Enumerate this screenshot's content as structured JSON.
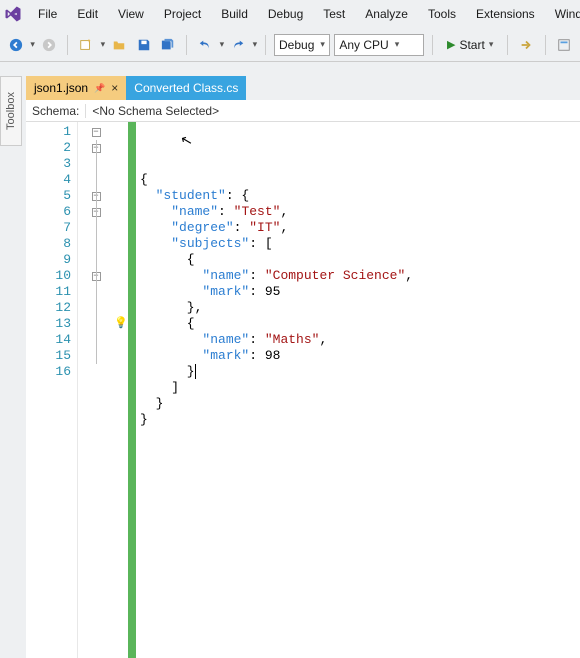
{
  "menu": {
    "items": [
      "File",
      "Edit",
      "View",
      "Project",
      "Build",
      "Debug",
      "Test",
      "Analyze",
      "Tools",
      "Extensions",
      "Wind"
    ]
  },
  "toolbar": {
    "config_dropdown": "Debug",
    "platform_dropdown": "Any CPU",
    "start_label": "Start"
  },
  "toolbox": {
    "label": "Toolbox"
  },
  "tabs": [
    {
      "title": "json1.json",
      "active": true,
      "pinned": true,
      "closeable": true
    },
    {
      "title": "Converted Class.cs",
      "active": false,
      "pinned": false,
      "closeable": false
    }
  ],
  "schema": {
    "label": "Schema:",
    "value": "<No Schema Selected>"
  },
  "code": {
    "line_numbers": [
      "1",
      "2",
      "3",
      "4",
      "5",
      "6",
      "7",
      "8",
      "9",
      "10",
      "11",
      "12",
      "13",
      "14",
      "15",
      "16"
    ],
    "fold_rows": [
      1,
      2,
      5,
      6,
      10
    ],
    "bulb_row": 13,
    "tokens": [
      [
        {
          "t": "{",
          "c": "p"
        }
      ],
      [
        {
          "t": "  ",
          "c": "p"
        },
        {
          "t": "\"student\"",
          "c": "k"
        },
        {
          "t": ": {",
          "c": "p"
        }
      ],
      [
        {
          "t": "    ",
          "c": "p"
        },
        {
          "t": "\"name\"",
          "c": "k"
        },
        {
          "t": ": ",
          "c": "p"
        },
        {
          "t": "\"Test\"",
          "c": "s"
        },
        {
          "t": ",",
          "c": "p"
        }
      ],
      [
        {
          "t": "    ",
          "c": "p"
        },
        {
          "t": "\"degree\"",
          "c": "k"
        },
        {
          "t": ": ",
          "c": "p"
        },
        {
          "t": "\"IT\"",
          "c": "s"
        },
        {
          "t": ",",
          "c": "p"
        }
      ],
      [
        {
          "t": "    ",
          "c": "p"
        },
        {
          "t": "\"subjects\"",
          "c": "k"
        },
        {
          "t": ": [",
          "c": "p"
        }
      ],
      [
        {
          "t": "      {",
          "c": "p"
        }
      ],
      [
        {
          "t": "        ",
          "c": "p"
        },
        {
          "t": "\"name\"",
          "c": "k"
        },
        {
          "t": ": ",
          "c": "p"
        },
        {
          "t": "\"Computer Science\"",
          "c": "s"
        },
        {
          "t": ",",
          "c": "p"
        }
      ],
      [
        {
          "t": "        ",
          "c": "p"
        },
        {
          "t": "\"mark\"",
          "c": "k"
        },
        {
          "t": ": ",
          "c": "p"
        },
        {
          "t": "95",
          "c": "n"
        }
      ],
      [
        {
          "t": "      },",
          "c": "p"
        }
      ],
      [
        {
          "t": "      {",
          "c": "p"
        }
      ],
      [
        {
          "t": "        ",
          "c": "p"
        },
        {
          "t": "\"name\"",
          "c": "k"
        },
        {
          "t": ": ",
          "c": "p"
        },
        {
          "t": "\"Maths\"",
          "c": "s"
        },
        {
          "t": ",",
          "c": "p"
        }
      ],
      [
        {
          "t": "        ",
          "c": "p"
        },
        {
          "t": "\"mark\"",
          "c": "k"
        },
        {
          "t": ": ",
          "c": "p"
        },
        {
          "t": "98",
          "c": "n"
        }
      ],
      [
        {
          "t": "      }",
          "c": "p",
          "caret": true
        }
      ],
      [
        {
          "t": "    ]",
          "c": "p"
        }
      ],
      [
        {
          "t": "  }",
          "c": "p"
        }
      ],
      [
        {
          "t": "}",
          "c": "p"
        }
      ]
    ]
  }
}
